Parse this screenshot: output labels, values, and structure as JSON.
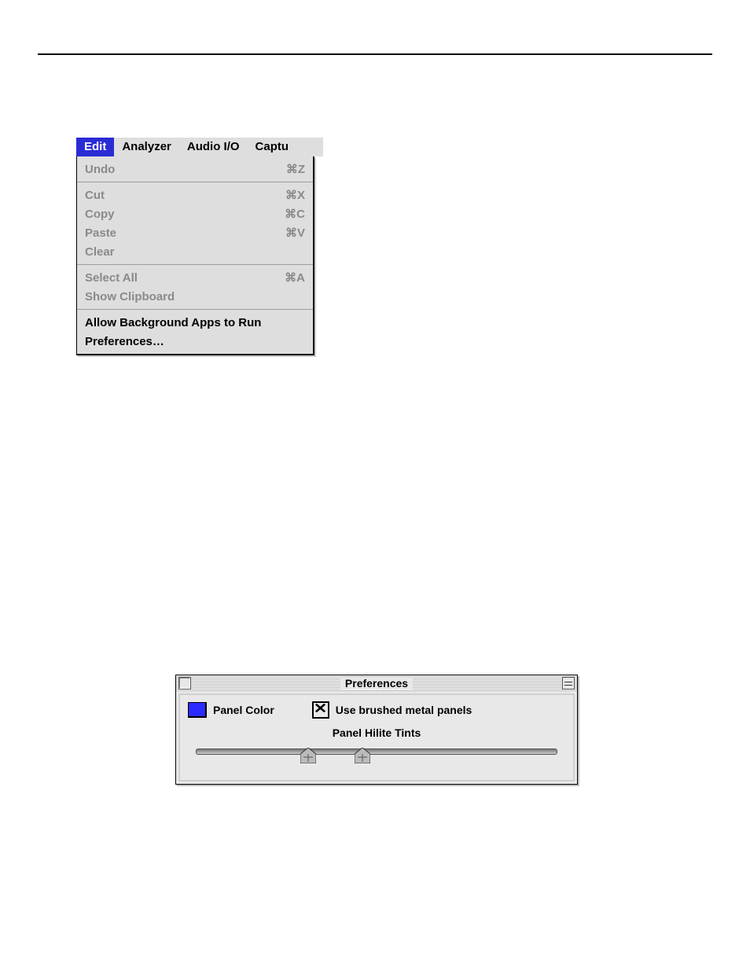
{
  "menubar": {
    "items": [
      {
        "label": "Edit",
        "selected": true
      },
      {
        "label": "Analyzer",
        "selected": false
      },
      {
        "label": "Audio I/O",
        "selected": false
      },
      {
        "label": "Captu",
        "selected": false,
        "cut": true
      }
    ]
  },
  "menu": {
    "groups": [
      [
        {
          "label": "Undo",
          "shortcut": "⌘Z",
          "enabled": false
        }
      ],
      [
        {
          "label": "Cut",
          "shortcut": "⌘X",
          "enabled": false
        },
        {
          "label": "Copy",
          "shortcut": "⌘C",
          "enabled": false
        },
        {
          "label": "Paste",
          "shortcut": "⌘V",
          "enabled": false
        },
        {
          "label": "Clear",
          "shortcut": "",
          "enabled": false
        }
      ],
      [
        {
          "label": "Select All",
          "shortcut": "⌘A",
          "enabled": false
        },
        {
          "label": "Show Clipboard",
          "shortcut": "",
          "enabled": false
        }
      ],
      [
        {
          "label": "Allow Background Apps to Run",
          "shortcut": "",
          "enabled": true
        },
        {
          "label": "Preferences…",
          "shortcut": "",
          "enabled": true
        }
      ]
    ]
  },
  "prefs": {
    "title": "Preferences",
    "panel_color_label": "Panel Color",
    "panel_color_value": "#2b2bff",
    "brushed_metal_label": "Use brushed metal panels",
    "brushed_metal_checked": true,
    "hilite_label": "Panel Hilite Tints",
    "slider_handles_pct": [
      31,
      46
    ]
  }
}
